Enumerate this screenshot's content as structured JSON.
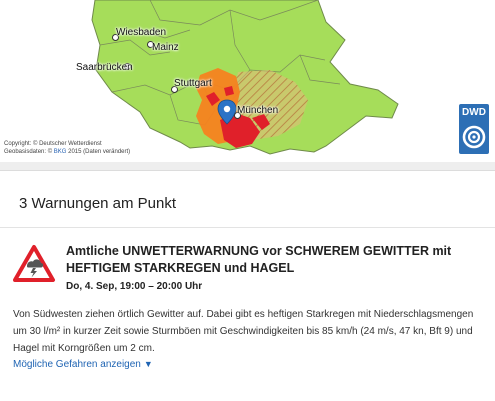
{
  "map": {
    "cities": [
      {
        "name": "Wiesbaden",
        "key": "wiesbaden"
      },
      {
        "name": "Mainz",
        "key": "mainz"
      },
      {
        "name": "Saarbrücken",
        "key": "saarbruecken"
      },
      {
        "name": "Stuttgart",
        "key": "stuttgart"
      },
      {
        "name": "München",
        "key": "muenchen"
      }
    ],
    "copyright_line1": "Copyright: © Deutscher Wetterdienst",
    "copyright_line2_prefix": "Geobasisdaten: © ",
    "copyright_line2_link": "BKG",
    "copyright_line2_suffix": " 2015 (Daten verändert)",
    "logo_text": "DWD",
    "colors": {
      "land": "#a6dd5a",
      "border": "#7a8a5a",
      "orange": "#f58220",
      "red": "#e0202a",
      "hatch": "#c8844a",
      "marker": "#2b73c6",
      "logo_bg": "#2d6fb5"
    }
  },
  "panel": {
    "title": "3 Warnungen am Punkt",
    "warning": {
      "icon": "thunderstorm-warning-icon",
      "icon_color": "#e0202a",
      "title": "Amtliche UNWETTERWARNUNG vor SCHWEREM GEWITTER mit HEFTIGEM STARKREGEN und HAGEL",
      "time": "Do, 4. Sep, 19:00 – 20:00 Uhr",
      "description": "Von Südwesten ziehen örtlich Gewitter auf. Dabei gibt es heftigen Starkregen mit Niederschlagsmengen um 30 l/m² in kurzer Zeit sowie Sturmböen mit Geschwindigkeiten bis 85 km/h (24 m/s, 47 kn, Bft 9) und Hagel mit Korngrößen um 2 cm.",
      "more_link": "Mögliche Gefahren anzeigen",
      "more_icon": "triangle-down-icon"
    }
  }
}
